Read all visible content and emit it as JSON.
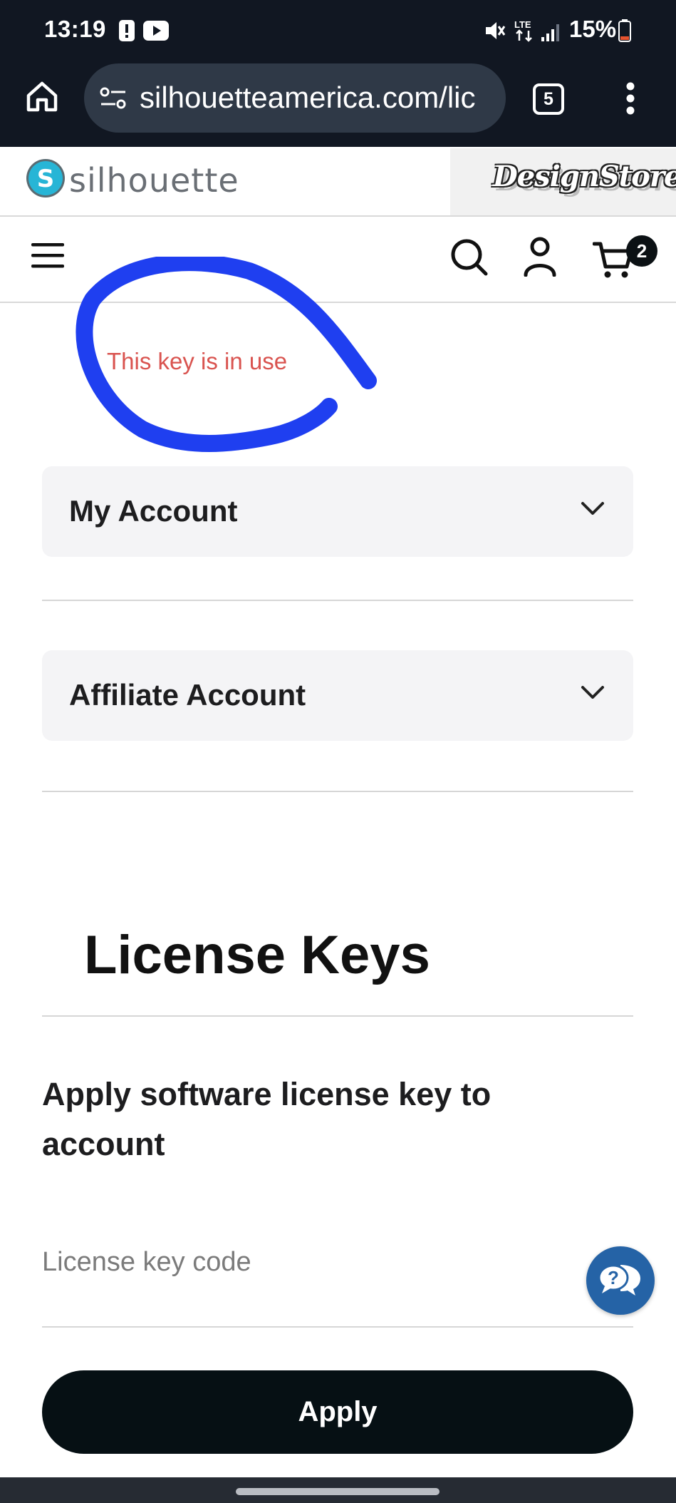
{
  "status_bar": {
    "time": "13:19",
    "battery_percent": "15%",
    "network": "LTE"
  },
  "browser": {
    "url": "silhouetteamerica.com/lic",
    "tab_count": "5"
  },
  "site_header": {
    "brand_name": "silhouette",
    "brand_logo_letter": "S",
    "design_store_label": "DesignStore",
    "cart_count": "2"
  },
  "annotation": {
    "text": "This key is in use",
    "ink_color": "#1f3ff0",
    "text_color": "#d9534f"
  },
  "account_menu": {
    "sections": [
      {
        "label": "My Account"
      },
      {
        "label": "Affiliate Account"
      }
    ]
  },
  "license_keys": {
    "heading": "License Keys",
    "subheading": "Apply software license key to account",
    "input_placeholder": "License key code",
    "input_value": "",
    "apply_label": "Apply"
  },
  "help_chat": {
    "glyph": "?"
  },
  "colors": {
    "top_bar": "#111722",
    "url_pill": "#2f3947",
    "apply_button": "#061014",
    "chat_button": "#2563a6"
  }
}
